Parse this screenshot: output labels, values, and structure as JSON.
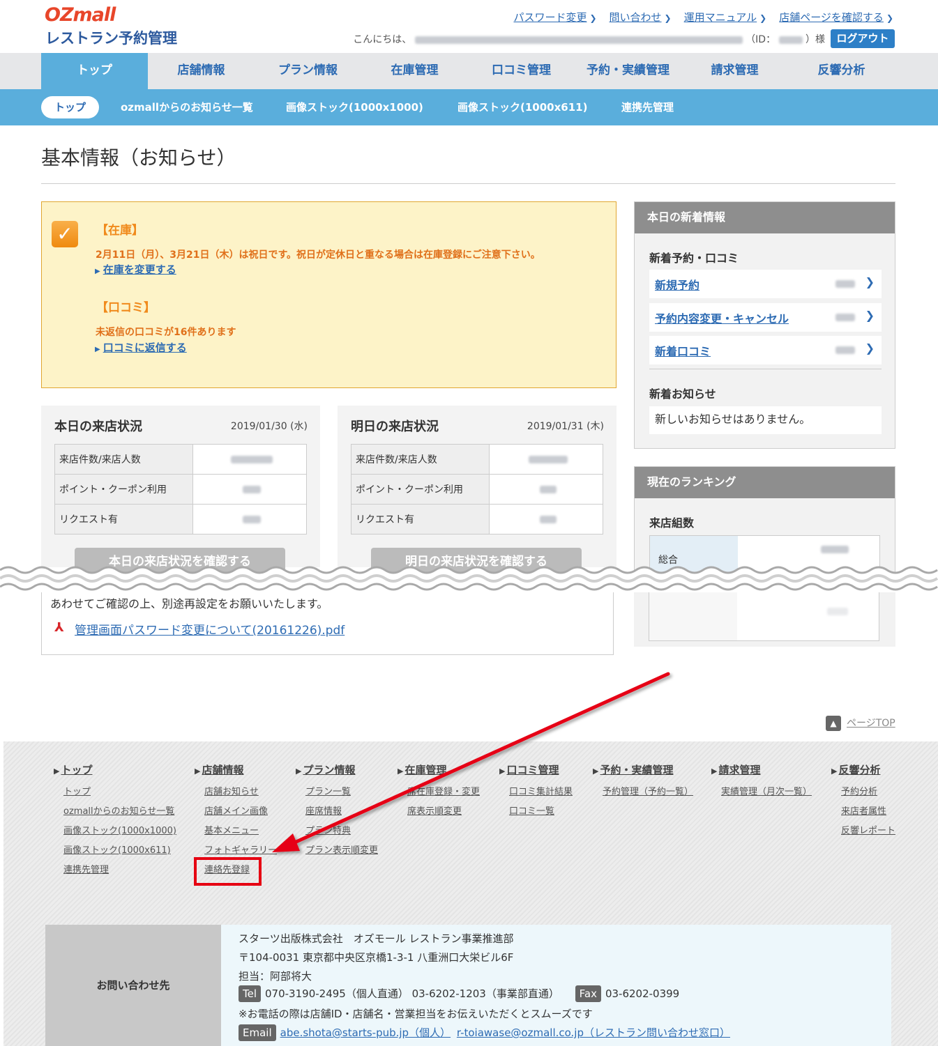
{
  "header": {
    "logo": "OZmall",
    "subtitle": "レストラン予約管理",
    "links": [
      "パスワード変更",
      "問い合わせ",
      "運用マニュアル",
      "店舗ページを確認する"
    ],
    "greeting_prefix": "こんにちは、",
    "id_label": "（ID：",
    "id_suffix": "）様",
    "logout": "ログアウト"
  },
  "main_nav": [
    "トップ",
    "店舗情報",
    "プラン情報",
    "在庫管理",
    "口コミ管理",
    "予約・実績管理",
    "請求管理",
    "反響分析"
  ],
  "sub_nav": [
    "トップ",
    "ozmallからのお知らせ一覧",
    "画像ストック(1000x1000)",
    "画像ストック(1000x611)",
    "連携先管理"
  ],
  "page_title": "基本情報（お知らせ）",
  "notice": {
    "stock_title": "【在庫】",
    "stock_text": "2月11日（月）、3月21日（木）は祝日です。祝日が定休日と重なる場合は在庫登録にご注意下さい。",
    "stock_link": "在庫を変更する",
    "review_title": "【口コミ】",
    "review_text": "未返信の口コミが16件あります",
    "review_link": "口コミに返信する"
  },
  "today": {
    "title": "本日の来店状況",
    "date": "2019/01/30 (水)",
    "rows": [
      "来店件数/来店人数",
      "ポイント・クーポン利用",
      "リクエスト有"
    ],
    "button": "本日の来店状況を確認する"
  },
  "tomorrow": {
    "title": "明日の来店状況",
    "date": "2019/01/31 (木)",
    "rows": [
      "来店件数/来店人数",
      "ポイント・クーポン利用",
      "リクエスト有"
    ],
    "button": "明日の来店状況を確認する"
  },
  "news": {
    "header": "本日の新着情報",
    "section1": "新着予約・口コミ",
    "items": [
      "新規予約",
      "予約内容変更・キャンセル",
      "新着口コミ"
    ],
    "section2": "新着お知らせ",
    "none": "新しいお知らせはありません。"
  },
  "ranking": {
    "header": "現在のランキング",
    "section": "来店組数",
    "row_label": "総合"
  },
  "lower": {
    "text": "あわせてご確認の上、別途再設定をお願いいたします。",
    "pdf_link": "管理画面パスワード変更について(20161226).pdf"
  },
  "pagetop": "ページTOP",
  "footer": {
    "cols": [
      {
        "head": "トップ",
        "items": [
          "トップ",
          "ozmallからのお知らせ一覧",
          "画像ストック(1000x1000)",
          "画像ストック(1000x611)",
          "連携先管理"
        ]
      },
      {
        "head": "店舗情報",
        "items": [
          "店舗お知らせ",
          "店舗メイン画像",
          "基本メニュー",
          "フォトギャラリー",
          "連絡先登録"
        ]
      },
      {
        "head": "プラン情報",
        "items": [
          "プラン一覧",
          "座席情報",
          "プラン特典",
          "プラン表示順変更"
        ]
      },
      {
        "head": "在庫管理",
        "items": [
          "席在庫登録・変更",
          "席表示順変更"
        ]
      },
      {
        "head": "口コミ管理",
        "items": [
          "口コミ集計結果",
          "口コミ一覧"
        ]
      },
      {
        "head": "予約・実績管理",
        "items": [
          "予約管理（予約一覧）"
        ]
      },
      {
        "head": "請求管理",
        "items": [
          "実績管理（月次一覧）"
        ]
      },
      {
        "head": "反響分析",
        "items": [
          "予約分析",
          "来店者属性",
          "反響レポート"
        ]
      }
    ]
  },
  "contact": {
    "label": "お問い合わせ先",
    "company": "スターツ出版株式会社　オズモール レストラン事業推進部",
    "address": "〒104-0031 東京都中央区京橋1-3-1 八重洲口大栄ビル6F",
    "person": "担当：阿部将大",
    "tel_tag": "Tel",
    "tel": "070-3190-2495（個人直通） 03-6202-1203（事業部直通）",
    "fax_tag": "Fax",
    "fax": "03-6202-0399",
    "note": "※お電話の際は店舗ID・店舗名・営業担当をお伝えいただくとスムーズです",
    "email_tag": "Email",
    "email1": "abe.shota@starts-pub.jp（個人）",
    "email2": "r-toiawase@ozmall.co.jp（レストラン問い合わせ窓口）"
  },
  "colors": {
    "accent": "#5aaedc",
    "link": "#2d6bb3",
    "notice_bg": "#fdf3c8",
    "arrow": "#e60012"
  }
}
